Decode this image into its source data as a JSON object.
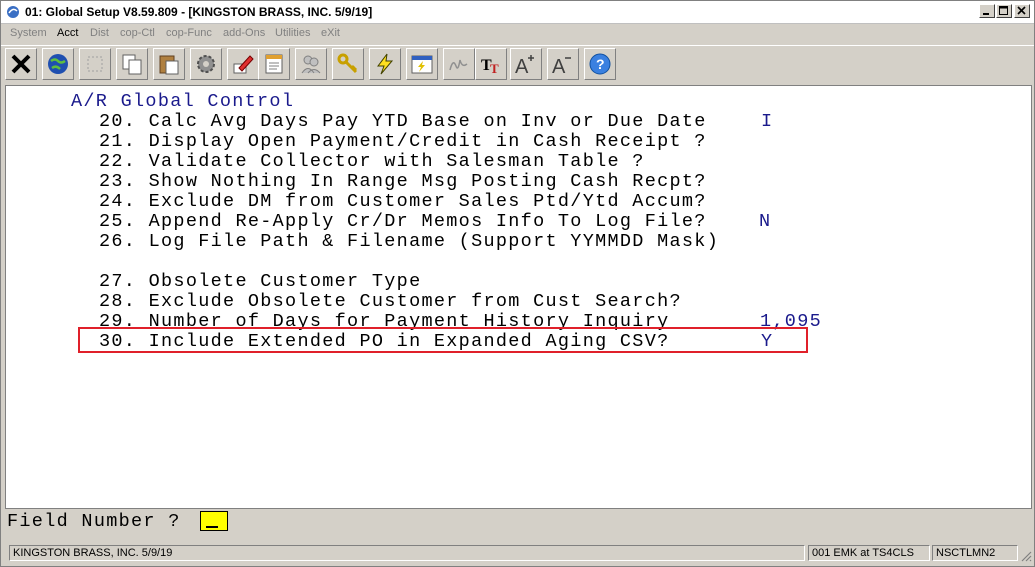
{
  "window": {
    "title": "01: Global Setup V8.59.809 - [KINGSTON BRASS, INC. 5/9/19]"
  },
  "menu": {
    "items": [
      "System",
      "Acct",
      "Dist",
      "cop-Ctl",
      "cop-Func",
      "add-Ons",
      "Utilities",
      "eXit"
    ],
    "active": "Acct"
  },
  "screen": {
    "heading": "A/R Global Control",
    "fields": [
      {
        "num": "20.",
        "label": "Calc Avg Days Pay YTD Base on Inv or Due Date",
        "value": "I"
      },
      {
        "num": "21.",
        "label": "Display Open Payment/Credit in Cash Receipt ?",
        "value": ""
      },
      {
        "num": "22.",
        "label": "Validate Collector with Salesman Table ?",
        "value": ""
      },
      {
        "num": "23.",
        "label": "Show Nothing In Range Msg Posting Cash Recpt?",
        "value": ""
      },
      {
        "num": "24.",
        "label": "Exclude DM from Customer Sales Ptd/Ytd Accum?",
        "value": ""
      },
      {
        "num": "25.",
        "label": "Append Re-Apply Cr/Dr Memos Info To Log File?",
        "value": "N"
      },
      {
        "num": "26.",
        "label": "Log File Path & Filename (Support YYMMDD Mask)",
        "value": ""
      },
      {
        "num": "27.",
        "label": "Obsolete Customer Type",
        "value": ""
      },
      {
        "num": "28.",
        "label": "Exclude Obsolete Customer from Cust Search?",
        "value": ""
      },
      {
        "num": "29.",
        "label": "Number of Days for Payment History Inquiry",
        "value": "1,095"
      },
      {
        "num": "30.",
        "label": "Include Extended PO in Expanded Aging CSV?",
        "value": "Y"
      }
    ]
  },
  "prompt": {
    "label": "Field Number ?",
    "value": ""
  },
  "status": {
    "company": "KINGSTON BRASS, INC. 5/9/19",
    "session": "001 EMK at TS4CLS",
    "program": "NSCTLMN2"
  },
  "colors": {
    "heading": "#1a1a8c",
    "highlight": "#e0202a",
    "input_bg": "#ffff00"
  },
  "toolbar_icons": [
    "close-x-icon",
    "globe-icon",
    "blank-icon",
    "copy-icon",
    "paste-icon",
    "gear-icon",
    "edit-pencil-icon",
    "notepad-icon",
    "people-icon",
    "keys-icon",
    "lightning-icon",
    "calendar-lightning-icon",
    "signature-icon",
    "font-tt-icon",
    "font-increase-icon",
    "font-decrease-icon",
    "help-icon"
  ]
}
